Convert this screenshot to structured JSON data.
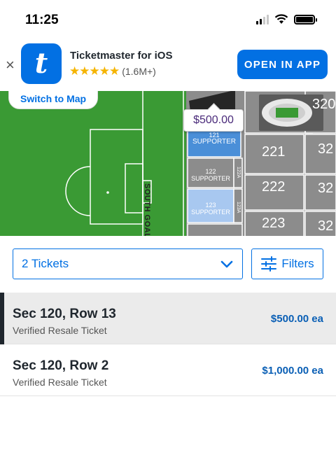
{
  "status_bar": {
    "time": "11:25"
  },
  "app_banner": {
    "close_glyph": "×",
    "icon_letter": "t",
    "app_name": "Ticketmaster for iOS",
    "stars": "★★★★★",
    "rating_count": "(1.6M+)",
    "open_label": "OPEN IN APP"
  },
  "map": {
    "switch_label": "Switch to Map",
    "price_tag": "$500.00",
    "goal_label": "SOUTH GOAL",
    "sections": {
      "s121_num": "121",
      "s121_name": "SUPPORTER",
      "s122_num": "122",
      "s122_name": "SUPPORTER",
      "s123_num": "123",
      "s123_name": "SUPPORTER",
      "a122": "122A",
      "a123": "123A",
      "s221": "221",
      "s222": "222",
      "s223": "223",
      "s320": "320",
      "s32a": "32",
      "s32b": "32",
      "s32c": "32"
    },
    "colors": {
      "pitch": "#3a9a34",
      "available": "#4a8fd8",
      "section": "#8c8c8c"
    }
  },
  "filters": {
    "quantity_value": "2 Tickets",
    "filters_label": "Filters"
  },
  "listings": [
    {
      "title": "Sec 120, Row 13",
      "subtitle": "Verified Resale Ticket",
      "price": "$500.00 ea"
    },
    {
      "title": "Sec 120, Row 2",
      "subtitle": "Verified Resale Ticket",
      "price": "$1,000.00 ea"
    }
  ],
  "colors": {
    "brand": "#0270e3"
  }
}
